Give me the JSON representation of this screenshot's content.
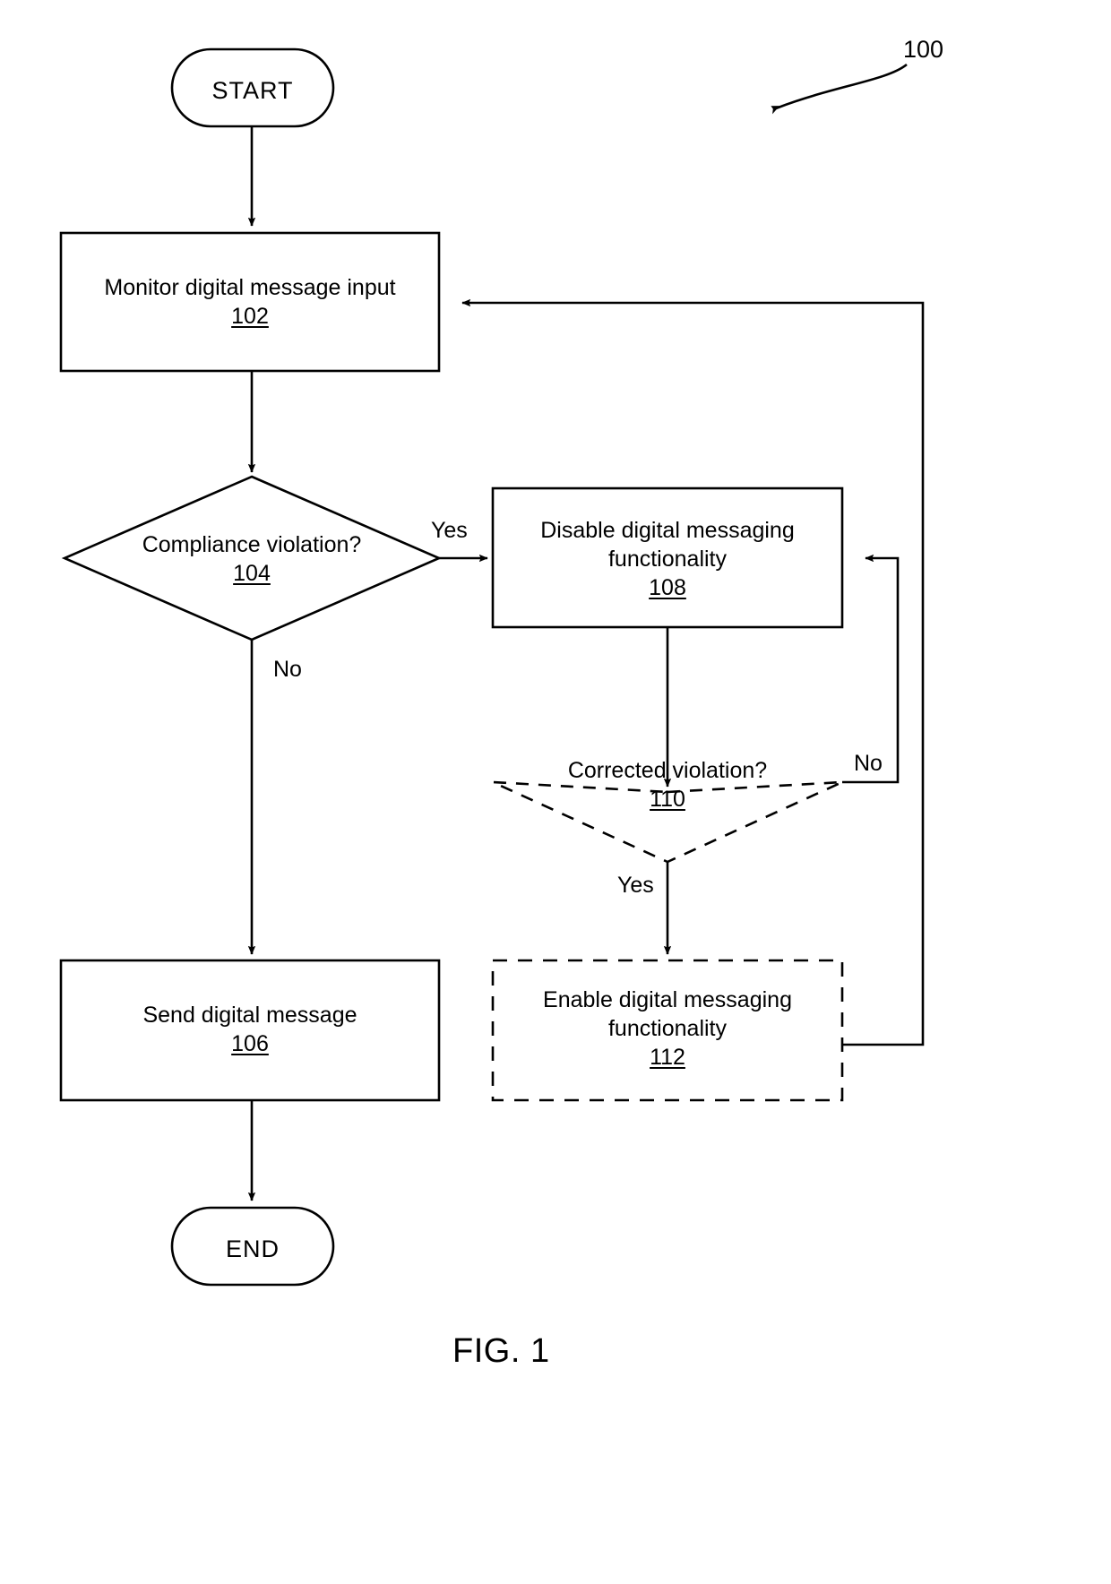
{
  "figure": {
    "caption": "FIG. 1",
    "callout": "100"
  },
  "nodes": {
    "start": {
      "label": "START",
      "shape": "terminator"
    },
    "end": {
      "label": "END",
      "shape": "terminator"
    },
    "monitor": {
      "text": "Monitor digital message input",
      "ref": "102",
      "shape": "process",
      "style": "solid"
    },
    "compliance": {
      "text": "Compliance violation?",
      "ref": "104",
      "shape": "decision",
      "style": "solid"
    },
    "send": {
      "text": "Send digital message",
      "ref": "106",
      "shape": "process",
      "style": "solid"
    },
    "disable": {
      "line1": "Disable digital messaging",
      "line2": "functionality",
      "ref": "108",
      "shape": "process",
      "style": "solid"
    },
    "corrected": {
      "text": "Corrected violation?",
      "ref": "110",
      "shape": "decision",
      "style": "dashed"
    },
    "enable": {
      "line1": "Enable digital messaging",
      "line2": "functionality",
      "ref": "112",
      "shape": "process",
      "style": "dashed"
    }
  },
  "edge_labels": {
    "compliance_yes": "Yes",
    "compliance_no": "No",
    "corrected_no": "No",
    "corrected_yes": "Yes"
  },
  "colors": {
    "stroke": "#000000",
    "background": "#ffffff",
    "text": "#000000"
  }
}
